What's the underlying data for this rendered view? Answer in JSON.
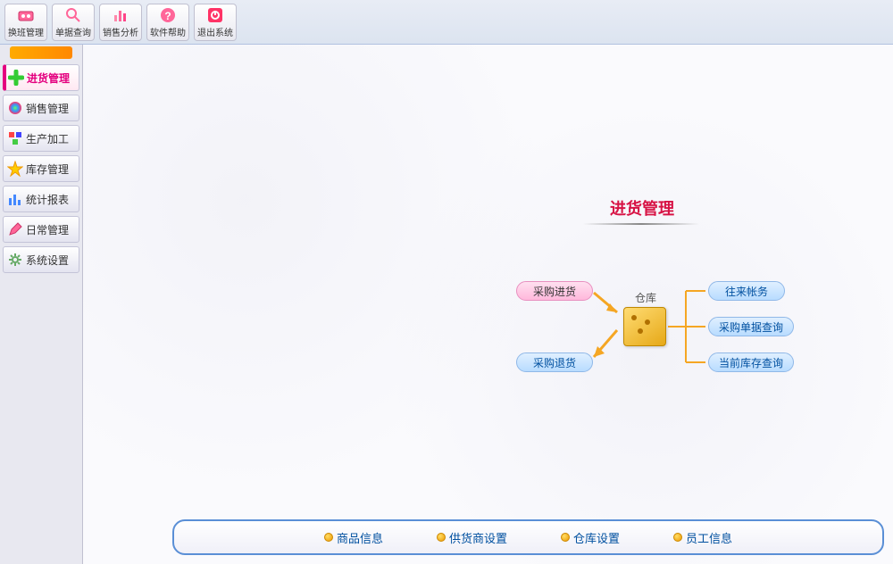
{
  "toolbar": [
    {
      "id": "shift-mgmt",
      "label": "换班管理",
      "icon": "shift"
    },
    {
      "id": "receipt-query",
      "label": "单据查询",
      "icon": "search"
    },
    {
      "id": "sales-analysis",
      "label": "销售分析",
      "icon": "chart"
    },
    {
      "id": "help",
      "label": "软件帮助",
      "icon": "help"
    },
    {
      "id": "exit",
      "label": "退出系统",
      "icon": "exit"
    }
  ],
  "sidebar": [
    {
      "id": "purchase",
      "label": "进货管理",
      "active": true,
      "icon": "plus"
    },
    {
      "id": "sales",
      "label": "销售管理",
      "active": false,
      "icon": "ball"
    },
    {
      "id": "production",
      "label": "生产加工",
      "active": false,
      "icon": "blocks"
    },
    {
      "id": "inventory",
      "label": "库存管理",
      "active": false,
      "icon": "star"
    },
    {
      "id": "reports",
      "label": "统计报表",
      "active": false,
      "icon": "bars"
    },
    {
      "id": "daily",
      "label": "日常管理",
      "active": false,
      "icon": "pencil"
    },
    {
      "id": "settings",
      "label": "系统设置",
      "active": false,
      "icon": "gear"
    }
  ],
  "diagram": {
    "title": "进货管理",
    "hub_label": "仓库",
    "left_nodes": [
      {
        "id": "purchase-in",
        "label": "采购进货",
        "style": "pink"
      },
      {
        "id": "purchase-return",
        "label": "采购退货",
        "style": "blue"
      }
    ],
    "right_nodes": [
      {
        "id": "accounts",
        "label": "往来帐务",
        "style": "blue"
      },
      {
        "id": "order-query",
        "label": "采购单据查询",
        "style": "blue"
      },
      {
        "id": "stock-query",
        "label": "当前库存查询",
        "style": "blue"
      }
    ]
  },
  "bottom_links": [
    {
      "id": "goods-info",
      "label": "商品信息"
    },
    {
      "id": "supplier-settings",
      "label": "供货商设置"
    },
    {
      "id": "warehouse-settings",
      "label": "仓库设置"
    },
    {
      "id": "staff-info",
      "label": "员工信息"
    }
  ]
}
